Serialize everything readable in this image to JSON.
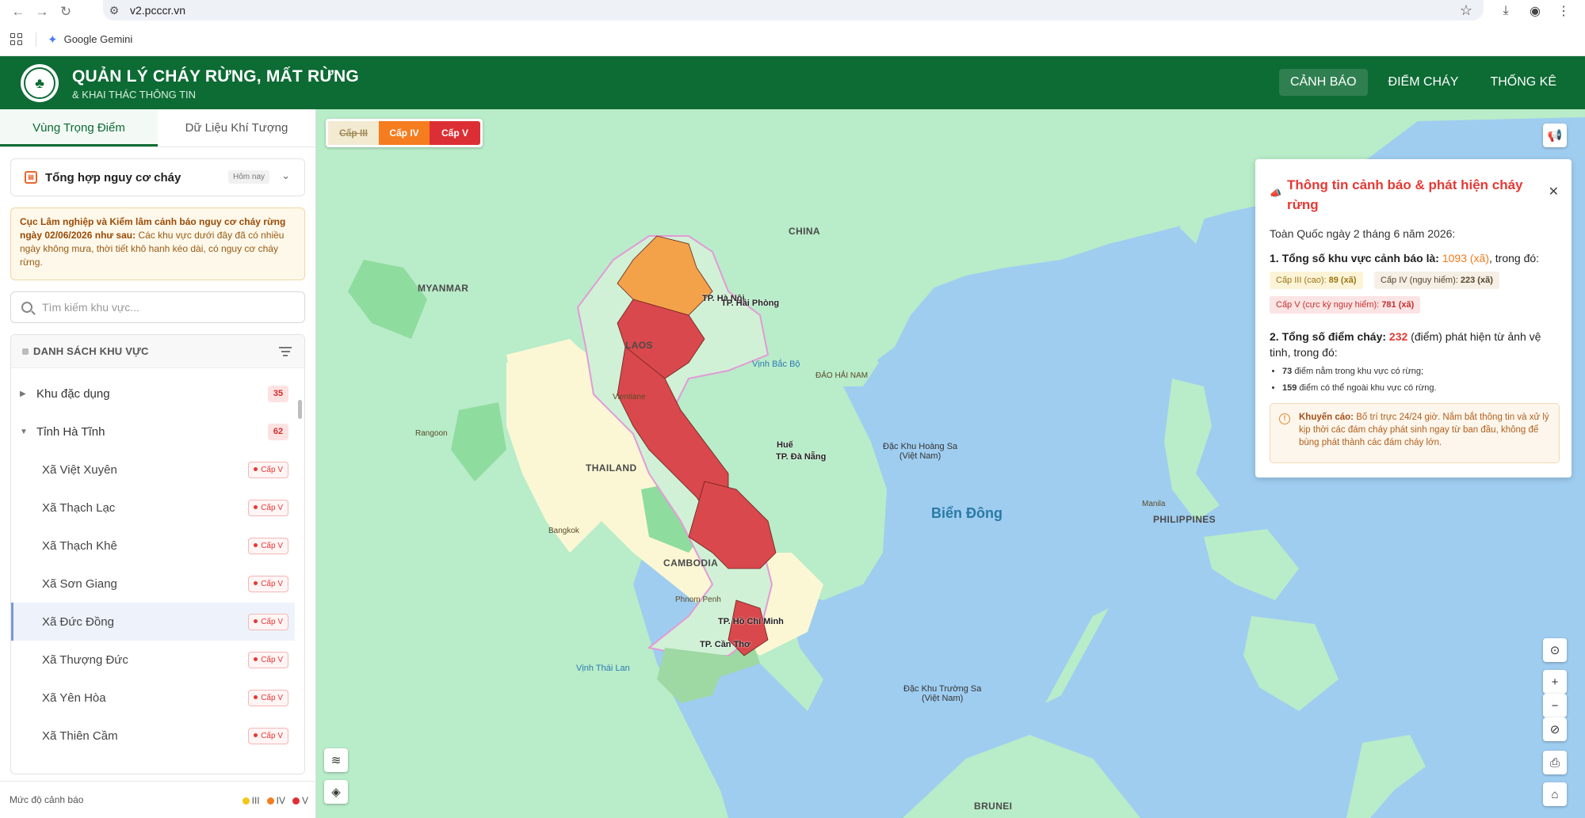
{
  "browser": {
    "url": "v2.pcccr.vn",
    "bookmark": "Google Gemini"
  },
  "header": {
    "title": "QUẢN LÝ CHÁY RỪNG, MẤT RỪNG",
    "subtitle": "& KHAI THÁC THÔNG TIN",
    "nav": [
      "CẢNH BÁO",
      "ĐIỂM CHÁY",
      "THỐNG KÊ"
    ]
  },
  "sidebar": {
    "tabs": [
      "Vùng Trọng Điểm",
      "Dữ Liệu Khí Tượng"
    ],
    "summary": {
      "title": "Tổng hợp nguy cơ cháy",
      "date_label": "Hôm nay"
    },
    "alert": {
      "bold": "Cục Lâm nghiệp và Kiểm lâm cảnh báo nguy cơ cháy rừng ngày 02/06/2026 như sau:",
      "text": "Các khu vực dưới đây đã có nhiều ngày không mưa, thời tiết khô hanh kéo dài, có nguy cơ cháy rừng."
    },
    "search_placeholder": "Tìm kiếm khu vực...",
    "region_header": "DANH SÁCH KHU VỰC",
    "groups": [
      {
        "label": "Khu đặc dụng",
        "count": "35"
      },
      {
        "label": "Tỉnh Hà Tĩnh",
        "count": "62"
      }
    ],
    "items": [
      {
        "label": "Xã Việt Xuyên",
        "level": "Cấp V"
      },
      {
        "label": "Xã Thạch Lạc",
        "level": "Cấp V"
      },
      {
        "label": "Xã Thạch Khê",
        "level": "Cấp V"
      },
      {
        "label": "Xã Sơn Giang",
        "level": "Cấp V"
      },
      {
        "label": "Xã Đức Đồng",
        "level": "Cấp V"
      },
      {
        "label": "Xã Thượng Đức",
        "level": "Cấp V"
      },
      {
        "label": "Xã Yên Hòa",
        "level": "Cấp V"
      },
      {
        "label": "Xã Thiên Cầm",
        "level": "Cấp V"
      }
    ],
    "legend": {
      "title": "Mức độ cảnh báo",
      "levels": [
        {
          "label": "III",
          "color": "#f5c518"
        },
        {
          "label": "IV",
          "color": "#f57c1f"
        },
        {
          "label": "V",
          "color": "#dc2f35"
        }
      ]
    }
  },
  "map": {
    "level_toggle": [
      "Cấp III",
      "Cấp IV",
      "Cấp V"
    ],
    "labels": {
      "china": "CHINA",
      "myanmar": "MYANMAR",
      "laos": "LAOS",
      "thailand": "THAILAND",
      "cambodia": "CAMBODIA",
      "philippines": "PHILIPPINES",
      "brunei": "BRUNEI",
      "gulf_tonkin": "Vịnh Bắc Bộ",
      "gulf_thailand": "Vịnh Thái Lan",
      "hainan": "ĐẢO HẢI NAM",
      "east_sea": "Biển Đông",
      "paracel_1": "Đặc Khu Hoàng Sa",
      "paracel_2": "(Việt Nam)",
      "spratly_1": "Đặc Khu Trường Sa",
      "spratly_2": "(Việt Nam)",
      "hanoi": "TP. Hà Nội",
      "haiphong": "TP. Hải Phòng",
      "hue": "Huế",
      "danang": "TP. Đà Nẵng",
      "hcm": "TP. Hồ Chí Minh",
      "cantho": "TP. Cần Thơ",
      "vientiane": "Vientiane",
      "bangkok": "Bangkok",
      "phnompenh": "Phnom Penh",
      "yangon": "Rangoon",
      "manila": "Manila"
    },
    "colors": {
      "sea": "#9fcdf0",
      "land": "#b9ecc9",
      "forest": "#8fdc9f",
      "plain": "#fbf7d4",
      "level_v": "#d9484c",
      "level_iv": "#f3a24a"
    }
  },
  "info": {
    "title": "Thông tin cảnh báo & phát hiện cháy rừng",
    "date": "Toàn Quốc ngày 2 tháng 6 năm 2026:",
    "total_prefix": "1. Tổng số khu vực cảnh báo là:",
    "total_value": "1093 (xã)",
    "total_suffix": ", trong đó:",
    "chip_iii_label": "Cấp III (cao):",
    "chip_iii_value": "89 (xã)",
    "chip_iv_label": "Cấp IV (nguy hiểm):",
    "chip_iv_value": "223 (xã)",
    "chip_v_label": "Cấp V (cực kỳ nguy hiểm):",
    "chip_v_value": "781 (xã)",
    "fire_prefix": "2. Tổng số điểm cháy:",
    "fire_value": "232",
    "fire_suffix": "(điểm) phát hiện từ ảnh vệ tinh, trong đó:",
    "bullet_1_value": "73",
    "bullet_1_text": "điểm nằm trong khu vực có rừng;",
    "bullet_2_value": "159",
    "bullet_2_text": "điểm có thể ngoài khu vực có rừng.",
    "advice_label": "Khuyến cáo:",
    "advice_text": "Bố trí trực 24/24 giờ. Nắm bắt thông tin và xử lý kịp thời các đám cháy phát sinh ngay từ ban đầu, không để bùng phát thành các đám cháy lớn."
  }
}
